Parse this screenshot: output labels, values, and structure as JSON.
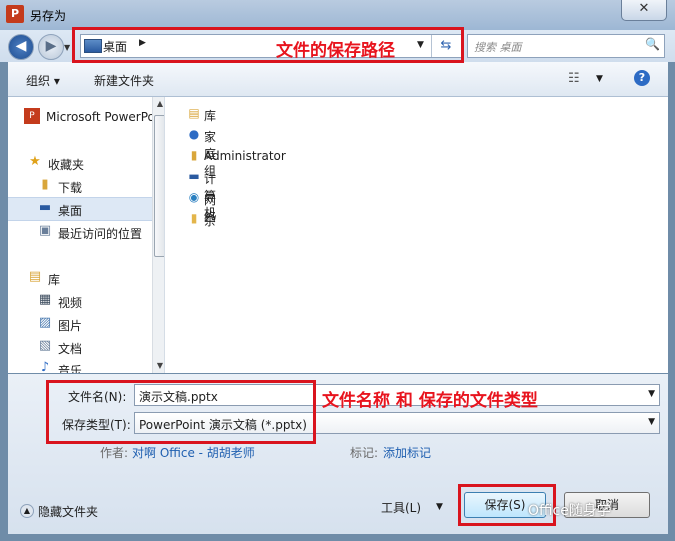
{
  "window": {
    "title": "另存为",
    "app_icon": "P"
  },
  "address": {
    "location": "桌面",
    "search_placeholder": "搜索 桌面",
    "annotation": "文件的保存路径"
  },
  "toolbar": {
    "organize": "组织 ▾",
    "new_folder": "新建文件夹"
  },
  "nav": {
    "items": [
      {
        "label": "Microsoft PowerPoint",
        "icon": "powerpoint-icon"
      },
      {
        "label": "收藏夹",
        "icon": "star-icon"
      },
      {
        "label": "下载",
        "icon": "download-folder-icon"
      },
      {
        "label": "桌面",
        "icon": "desktop-icon"
      },
      {
        "label": "最近访问的位置",
        "icon": "recent-places-icon"
      },
      {
        "label": "库",
        "icon": "library-icon"
      },
      {
        "label": "视频",
        "icon": "video-icon"
      },
      {
        "label": "图片",
        "icon": "pictures-icon"
      },
      {
        "label": "文档",
        "icon": "documents-icon"
      },
      {
        "label": "音乐",
        "icon": "music-icon"
      }
    ]
  },
  "files": [
    {
      "label": "库",
      "icon": "library-icon"
    },
    {
      "label": "家庭组",
      "icon": "homegroup-icon"
    },
    {
      "label": "Administrator",
      "icon": "user-folder-icon"
    },
    {
      "label": "计算机",
      "icon": "computer-icon"
    },
    {
      "label": "网络",
      "icon": "network-icon"
    },
    {
      "label": "杂",
      "icon": "folder-icon"
    }
  ],
  "form": {
    "filename_label": "文件名(N):",
    "filename_value": "演示文稿.pptx",
    "filetype_label": "保存类型(T):",
    "filetype_value": "PowerPoint 演示文稿 (*.pptx)",
    "author_label": "作者:",
    "author_value": "对啊 Office - 胡胡老师",
    "tags_label": "标记:",
    "tags_value": "添加标记",
    "annotation": "文件名称 和 保存的文件类型"
  },
  "footer": {
    "hide_folders": "隐藏文件夹",
    "tools": "工具(L)",
    "save": "保存(S)",
    "cancel": "取消"
  },
  "watermark": "Office随身学"
}
